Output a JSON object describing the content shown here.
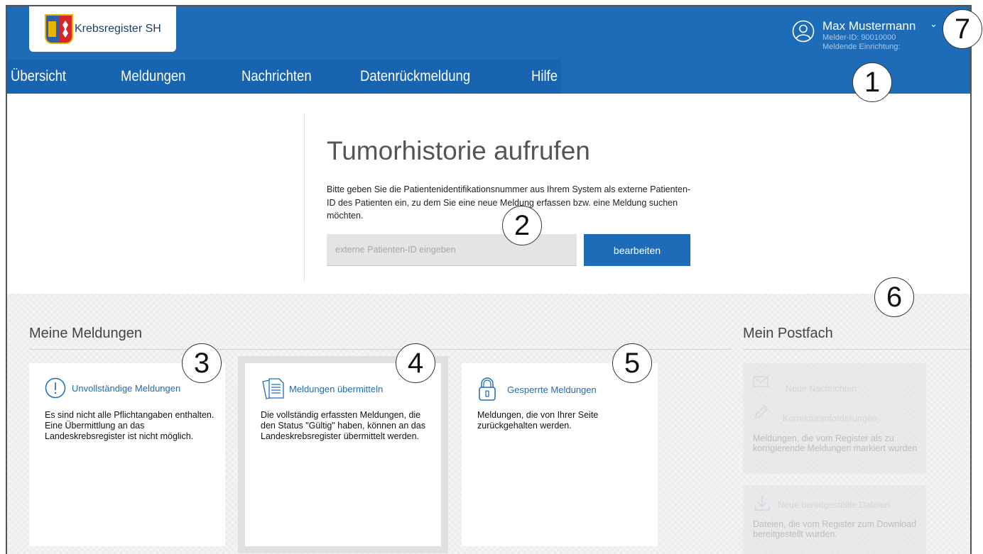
{
  "logo": {
    "text": "Krebsregister SH"
  },
  "nav": {
    "items": [
      {
        "label": "Übersicht"
      },
      {
        "label": "Meldungen"
      },
      {
        "label": "Nachrichten"
      },
      {
        "label": "Datenrückmeldung"
      },
      {
        "label": "Hilfe"
      }
    ]
  },
  "user": {
    "name": "Max Mustermann",
    "melder_id": "Melder-ID: 90010000",
    "einrichtung": "Meldende Einrichtung:"
  },
  "search": {
    "title": "Tumorhistorie aufrufen",
    "description": "Bitte geben Sie die Patientenidentifikationsnummer aus Ihrem System als externe Patienten-ID des Patienten ein, zu dem Sie eine neue Meldung erfassen bzw. eine Meldung suchen möchten.",
    "placeholder": "externe Patienten-ID eingeben",
    "button_label": "bearbeiten"
  },
  "meldungen": {
    "title": "Meine Meldungen",
    "cards": [
      {
        "title": "Unvollständige Meldungen",
        "icon": "exclamation-circle-icon",
        "text": "Es sind nicht alle Pflichtangaben enthalten. Eine Übermittlung an das Landeskrebsregister ist nicht möglich."
      },
      {
        "title": "Meldungen übermitteln",
        "icon": "documents-icon",
        "text": "Die vollständig erfassten Meldungen, die den Status \"Gültig\" haben, können an das Landeskrebsregister übermittelt werden."
      },
      {
        "title": "Gesperrte Meldungen",
        "icon": "lock-icon",
        "text": "Meldungen, die von Ihrer Seite zurückgehalten werden."
      }
    ]
  },
  "postfach": {
    "title": "Mein Postfach",
    "neue_nachrichten": "Neue Nachrichten",
    "korrektur_title": "Korrekturanforderungen",
    "korrektur_text": "Meldungen, die vom Register als zu korrigierende Meldungen markiert wurden",
    "dateien_title": "Neue bereitgestellte Dateien",
    "dateien_text": "Dateien, die vom Register zum Download bereitgestellt wurden."
  },
  "callouts": [
    "1",
    "2",
    "3",
    "4",
    "5",
    "6",
    "7"
  ],
  "colors": {
    "brand_blue": "#1e6bb8",
    "nav_blue": "#1964b0"
  }
}
